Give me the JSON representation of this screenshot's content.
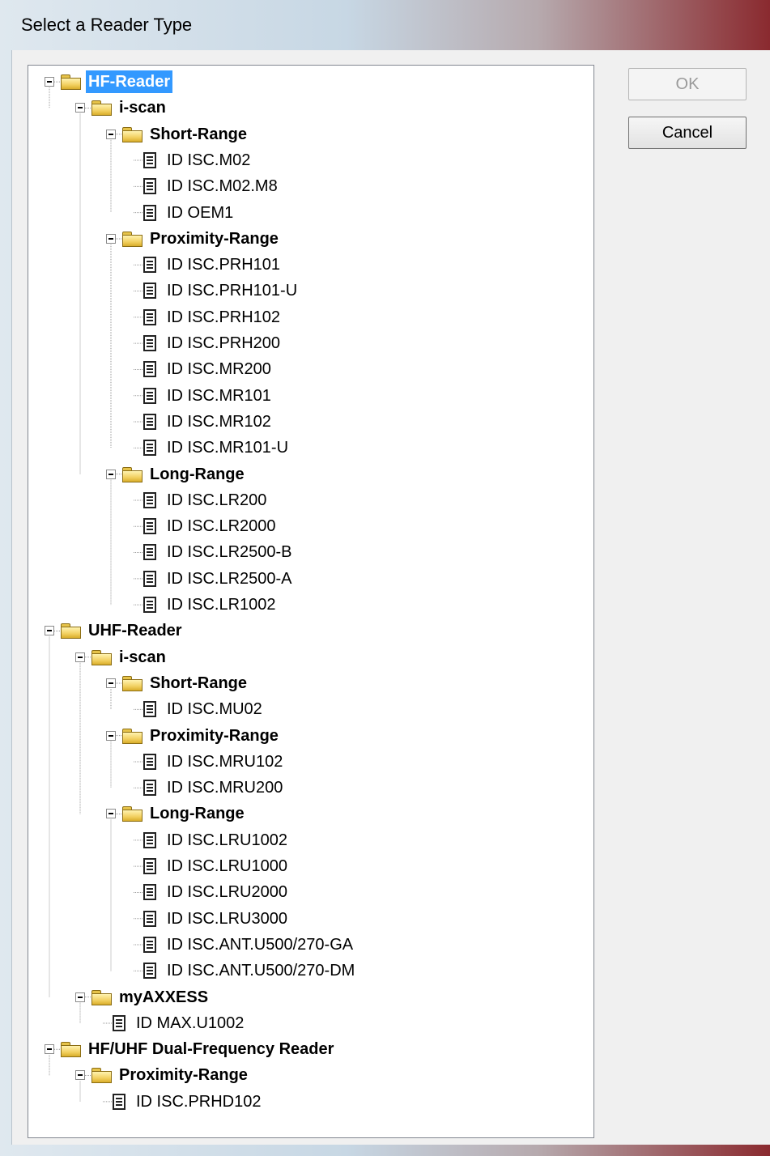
{
  "window": {
    "title": "Select a Reader Type"
  },
  "buttons": {
    "ok": "OK",
    "cancel": "Cancel"
  },
  "tree": [
    {
      "label": "HF-Reader",
      "level": 0,
      "type": "folder",
      "bold": true,
      "selected": true
    },
    {
      "label": "i-scan",
      "level": 1,
      "type": "folder",
      "bold": true
    },
    {
      "label": "Short-Range",
      "level": 2,
      "type": "folder",
      "bold": true
    },
    {
      "label": "ID ISC.M02",
      "level": 3,
      "type": "doc"
    },
    {
      "label": "ID ISC.M02.M8",
      "level": 3,
      "type": "doc"
    },
    {
      "label": "ID OEM1",
      "level": 3,
      "type": "doc"
    },
    {
      "label": "Proximity-Range",
      "level": 2,
      "type": "folder",
      "bold": true
    },
    {
      "label": "ID ISC.PRH101",
      "level": 3,
      "type": "doc"
    },
    {
      "label": "ID ISC.PRH101-U",
      "level": 3,
      "type": "doc"
    },
    {
      "label": "ID ISC.PRH102",
      "level": 3,
      "type": "doc"
    },
    {
      "label": "ID ISC.PRH200",
      "level": 3,
      "type": "doc"
    },
    {
      "label": "ID ISC.MR200",
      "level": 3,
      "type": "doc"
    },
    {
      "label": "ID ISC.MR101",
      "level": 3,
      "type": "doc"
    },
    {
      "label": "ID ISC.MR102",
      "level": 3,
      "type": "doc"
    },
    {
      "label": "ID ISC.MR101-U",
      "level": 3,
      "type": "doc"
    },
    {
      "label": "Long-Range",
      "level": 2,
      "type": "folder",
      "bold": true
    },
    {
      "label": "ID ISC.LR200",
      "level": 3,
      "type": "doc"
    },
    {
      "label": "ID ISC.LR2000",
      "level": 3,
      "type": "doc"
    },
    {
      "label": "ID ISC.LR2500-B",
      "level": 3,
      "type": "doc"
    },
    {
      "label": "ID ISC.LR2500-A",
      "level": 3,
      "type": "doc"
    },
    {
      "label": "ID ISC.LR1002",
      "level": 3,
      "type": "doc"
    },
    {
      "label": "UHF-Reader",
      "level": 0,
      "type": "folder",
      "bold": true
    },
    {
      "label": "i-scan",
      "level": 1,
      "type": "folder",
      "bold": true
    },
    {
      "label": "Short-Range",
      "level": 2,
      "type": "folder",
      "bold": true
    },
    {
      "label": "ID ISC.MU02",
      "level": 3,
      "type": "doc"
    },
    {
      "label": "Proximity-Range",
      "level": 2,
      "type": "folder",
      "bold": true
    },
    {
      "label": "ID ISC.MRU102",
      "level": 3,
      "type": "doc"
    },
    {
      "label": "ID ISC.MRU200",
      "level": 3,
      "type": "doc"
    },
    {
      "label": "Long-Range",
      "level": 2,
      "type": "folder",
      "bold": true
    },
    {
      "label": "ID ISC.LRU1002",
      "level": 3,
      "type": "doc"
    },
    {
      "label": "ID ISC.LRU1000",
      "level": 3,
      "type": "doc"
    },
    {
      "label": "ID ISC.LRU2000",
      "level": 3,
      "type": "doc"
    },
    {
      "label": "ID ISC.LRU3000",
      "level": 3,
      "type": "doc"
    },
    {
      "label": "ID ISC.ANT.U500/270-GA",
      "level": 3,
      "type": "doc"
    },
    {
      "label": "ID ISC.ANT.U500/270-DM",
      "level": 3,
      "type": "doc"
    },
    {
      "label": "myAXXESS",
      "level": 1,
      "type": "folder",
      "bold": true
    },
    {
      "label": "ID MAX.U1002",
      "level": 2,
      "type": "doc"
    },
    {
      "label": "HF/UHF Dual-Frequency Reader",
      "level": 0,
      "type": "folder",
      "bold": true
    },
    {
      "label": "Proximity-Range",
      "level": 1,
      "type": "folder",
      "bold": true
    },
    {
      "label": "ID ISC.PRHD102",
      "level": 2,
      "type": "doc"
    }
  ]
}
